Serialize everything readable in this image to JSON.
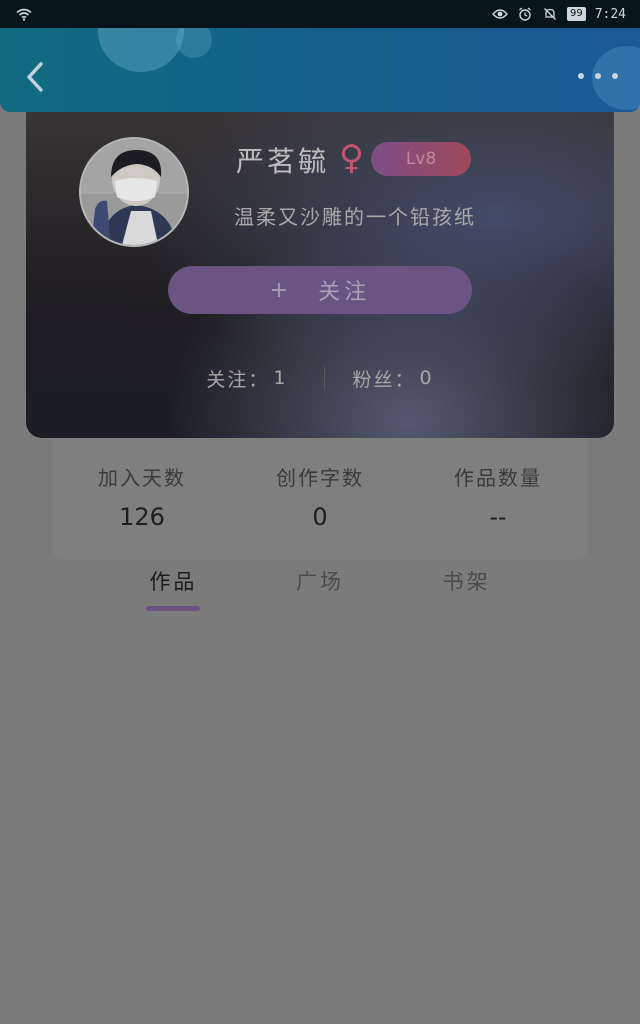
{
  "status_bar": {
    "time": "7:24",
    "battery": "99",
    "icons": [
      "wifi-icon",
      "eye-icon",
      "alarm-icon",
      "mute-icon",
      "battery-icon"
    ]
  },
  "header": {
    "back_icon": "chevron-left-icon",
    "more_icon": "more-dots-icon",
    "accent_color": "#155f8b"
  },
  "profile": {
    "nickname": "严茗毓",
    "gender_symbol": "♀",
    "level": "Lv8",
    "signature": "温柔又沙雕的一个铅孩纸",
    "follow_button": {
      "plus": "+",
      "label": "关注"
    },
    "following": {
      "label": "关注：",
      "value": "1"
    },
    "followers": {
      "label": "粉丝：",
      "value": "0"
    }
  },
  "stats": [
    {
      "label": "加入天数",
      "value": "126"
    },
    {
      "label": "创作字数",
      "value": "0"
    },
    {
      "label": "作品数量",
      "value": "--"
    }
  ],
  "tabs": [
    {
      "label": "作品",
      "active": true
    },
    {
      "label": "广场",
      "active": false
    },
    {
      "label": "书架",
      "active": false
    }
  ],
  "colors": {
    "follow_button": "#6b5383",
    "gender": "#c25670",
    "tab_indicator": "#6b5383"
  }
}
